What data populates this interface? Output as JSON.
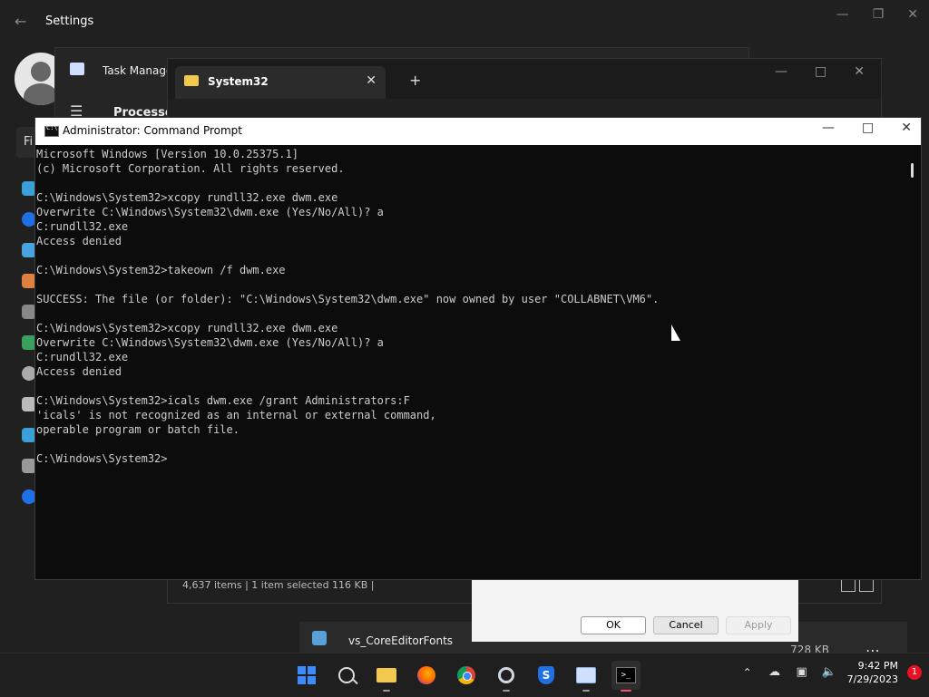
{
  "settings": {
    "title": "Settings",
    "search_label": "Fi"
  },
  "task_manager": {
    "title": "Task Manager",
    "tab": "Processes"
  },
  "explorer": {
    "tab_title": "System32",
    "status": "4,637 items  |  1 item selected  116 KB  |"
  },
  "dialog": {
    "ok": "OK",
    "cancel": "Cancel",
    "apply": "Apply"
  },
  "file_row": {
    "name": "vs_CoreEditorFonts",
    "size": "728 KB"
  },
  "cmd": {
    "title": "Administrator: Command Prompt",
    "lines": [
      "Microsoft Windows [Version 10.0.25375.1]",
      "(c) Microsoft Corporation. All rights reserved.",
      "",
      "C:\\Windows\\System32>xcopy rundll32.exe dwm.exe",
      "Overwrite C:\\Windows\\System32\\dwm.exe (Yes/No/All)? a",
      "C:rundll32.exe",
      "Access denied",
      "",
      "C:\\Windows\\System32>takeown /f dwm.exe",
      "",
      "SUCCESS: The file (or folder): \"C:\\Windows\\System32\\dwm.exe\" now owned by user \"COLLABNET\\VM6\".",
      "",
      "C:\\Windows\\System32>xcopy rundll32.exe dwm.exe",
      "Overwrite C:\\Windows\\System32\\dwm.exe (Yes/No/All)? a",
      "C:rundll32.exe",
      "Access denied",
      "",
      "C:\\Windows\\System32>icals dwm.exe /grant Administrators:F",
      "'icals' is not recognized as an internal or external command,",
      "operable program or batch file.",
      "",
      "C:\\Windows\\System32>"
    ]
  },
  "taskbar": {
    "time": "9:42 PM",
    "date": "7/29/2023",
    "notifications": "1"
  }
}
